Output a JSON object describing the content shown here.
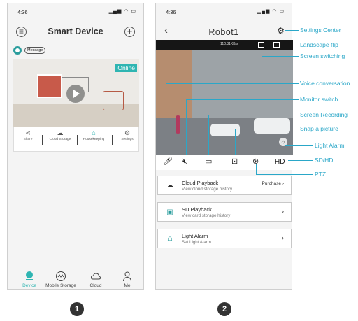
{
  "screen1": {
    "status_time": "4:36",
    "status_icons": "signal wifi battery",
    "title": "Smart Device",
    "left_icon": "menu-icon",
    "add_icon": "plus-icon",
    "message_label": "Message",
    "online_label": "Online",
    "actions": [
      {
        "label": "Share",
        "icon": "share-icon"
      },
      {
        "label": "Cloud Storage",
        "icon": "cloud-icon"
      },
      {
        "label": "Housekeeping",
        "icon": "home-icon"
      },
      {
        "label": "Settings",
        "icon": "gear-icon"
      }
    ],
    "tabs": [
      {
        "label": "Device",
        "icon": "device-icon",
        "active": true
      },
      {
        "label": "Mobile Storage",
        "icon": "mobile-storage-icon",
        "active": false
      },
      {
        "label": "Cloud",
        "icon": "cloud-icon",
        "active": false
      },
      {
        "label": "Me",
        "icon": "person-icon",
        "active": false
      }
    ],
    "number": "1",
    "accent_color": "#2fb5b2"
  },
  "screen2": {
    "status_time": "4:36",
    "title": "Robot1",
    "data_rate": "110.31KB/s",
    "controls": {
      "voice": "microphone-icon",
      "monitor": "speaker-mute-icon",
      "record": "record-icon",
      "snapshot": "camera-icon",
      "ptz": "ptz-icon",
      "hd_label": "HD"
    },
    "cards": [
      {
        "title": "Cloud Playback",
        "subtitle": "View cloud storage history",
        "right": "Purchase",
        "icon": "cloud-play-icon"
      },
      {
        "title": "SD Playback",
        "subtitle": "View card storage history",
        "right": "",
        "icon": "sd-card-icon"
      },
      {
        "title": "Light Alarm",
        "subtitle": "Set Light Alarm",
        "right": "",
        "icon": "alarm-light-icon"
      }
    ],
    "number": "2"
  },
  "callouts": [
    "Settings Center",
    "Landscape flip",
    "Screen switching",
    "Voice conversation",
    "Monitor switch",
    "Screen Recording",
    "Snap a picture",
    "Light Alarm",
    "SD/HD",
    "PTZ"
  ],
  "callout_color": "#2aa7c8"
}
